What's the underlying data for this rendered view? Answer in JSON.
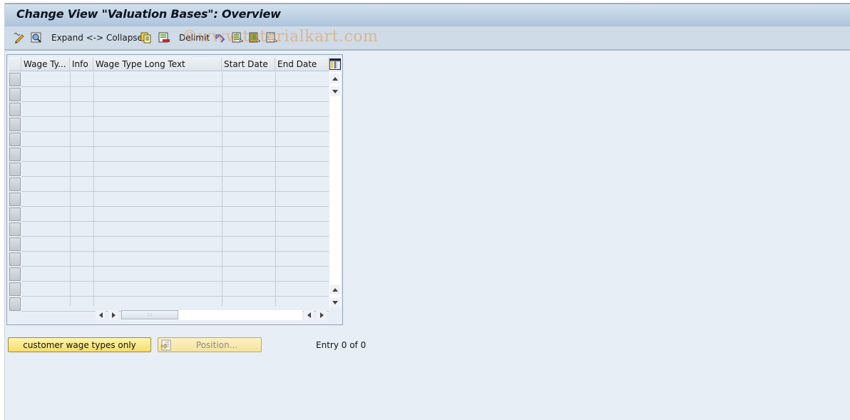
{
  "window": {
    "title": "Change View \"Valuation Bases\": Overview"
  },
  "toolbar": {
    "items": [
      {
        "icon": "display-change-icon",
        "label": ""
      },
      {
        "icon": "find-icon",
        "label": ""
      },
      {
        "icon": "",
        "label": "Expand <-> Collapse"
      },
      {
        "icon": "copy-icon",
        "label": ""
      },
      {
        "icon": "delete-icon",
        "label": ""
      },
      {
        "icon": "",
        "label": "Delimit"
      },
      {
        "icon": "undo-icon",
        "label": ""
      },
      {
        "icon": "select-all-icon",
        "label": ""
      },
      {
        "icon": "select-block-icon",
        "label": ""
      },
      {
        "icon": "deselect-all-icon",
        "label": ""
      }
    ],
    "expand_collapse_label": "Expand <-> Collapse",
    "delimit_label": "Delimit",
    "watermark": "©www.tutorialkart.com"
  },
  "table": {
    "columns": [
      "Wage Ty...",
      "Info",
      "Wage Type Long Text",
      "Start Date",
      "End Date"
    ],
    "rows": [],
    "visible_empty_rows": 16,
    "settings_icon": "column-settings-icon"
  },
  "footer": {
    "customer_button_label": "customer wage types only",
    "position_button_label": "Position...",
    "entry_text": "Entry 0 of 0"
  }
}
